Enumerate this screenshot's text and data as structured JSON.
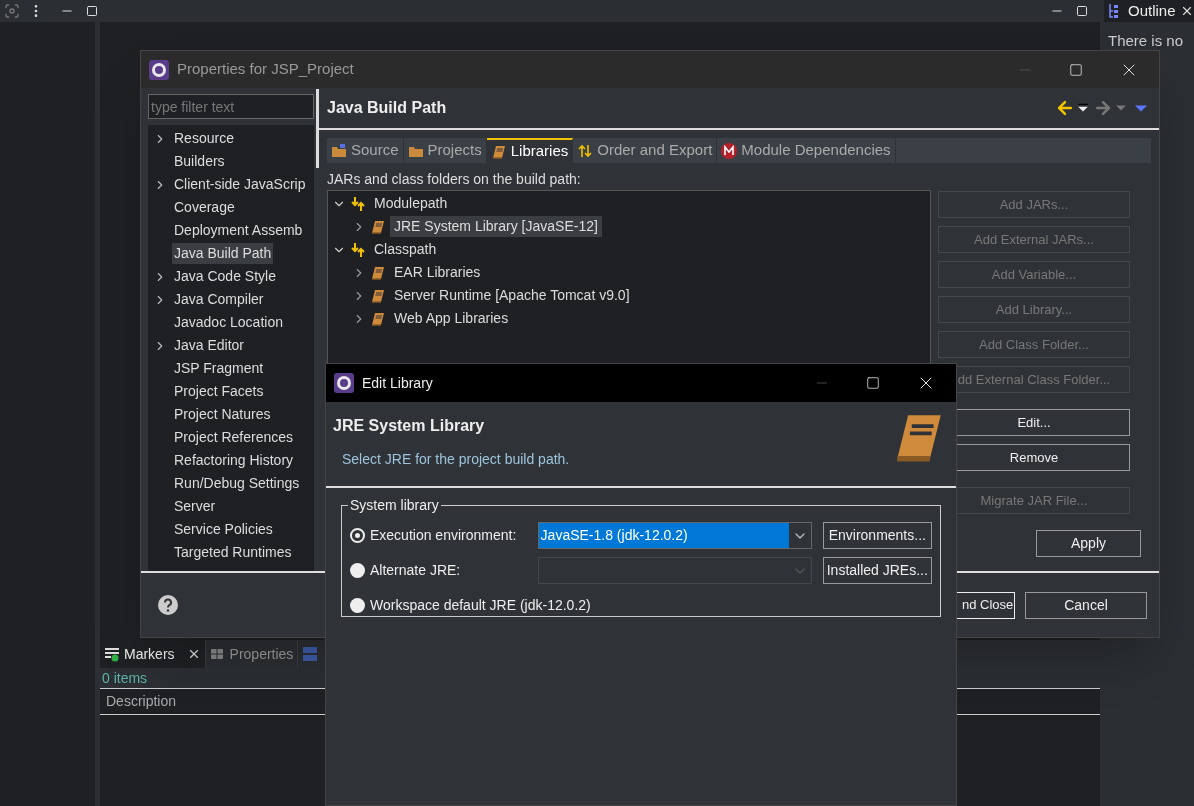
{
  "ide": {
    "outline": {
      "tab": "Outline",
      "message": "There is no"
    },
    "markers": {
      "tabs": [
        {
          "label": "Markers",
          "selected": true,
          "closable": true
        },
        {
          "label": "Properties",
          "selected": false,
          "closable": false
        }
      ],
      "count": "0 items",
      "columns": [
        "Description"
      ]
    }
  },
  "properties_dialog": {
    "title": "Properties for JSP_Project",
    "filter_placeholder": "type filter text",
    "nav": [
      {
        "label": "Resource",
        "expandable": true,
        "selected": false
      },
      {
        "label": "Builders",
        "expandable": false,
        "selected": false
      },
      {
        "label": "Client-side JavaScrip",
        "expandable": true,
        "selected": false
      },
      {
        "label": "Coverage",
        "expandable": false,
        "selected": false
      },
      {
        "label": "Deployment Assemb",
        "expandable": false,
        "selected": false
      },
      {
        "label": "Java Build Path",
        "expandable": false,
        "selected": true
      },
      {
        "label": "Java Code Style",
        "expandable": true,
        "selected": false
      },
      {
        "label": "Java Compiler",
        "expandable": true,
        "selected": false
      },
      {
        "label": "Javadoc Location",
        "expandable": false,
        "selected": false
      },
      {
        "label": "Java Editor",
        "expandable": true,
        "selected": false
      },
      {
        "label": "JSP Fragment",
        "expandable": false,
        "selected": false
      },
      {
        "label": "Project Facets",
        "expandable": false,
        "selected": false
      },
      {
        "label": "Project Natures",
        "expandable": false,
        "selected": false
      },
      {
        "label": "Project References",
        "expandable": false,
        "selected": false
      },
      {
        "label": "Refactoring History",
        "expandable": false,
        "selected": false
      },
      {
        "label": "Run/Debug Settings",
        "expandable": false,
        "selected": false
      },
      {
        "label": "Server",
        "expandable": false,
        "selected": false
      },
      {
        "label": "Service Policies",
        "expandable": false,
        "selected": false
      },
      {
        "label": "Targeted Runtimes",
        "expandable": false,
        "selected": false
      }
    ],
    "page_title": "Java Build Path",
    "tabs": [
      {
        "label": "Source",
        "kind": "source",
        "selected": false
      },
      {
        "label": "Projects",
        "kind": "projects",
        "selected": false
      },
      {
        "label": "Libraries",
        "kind": "libraries",
        "selected": true
      },
      {
        "label": "Order and Export",
        "kind": "order",
        "selected": false
      },
      {
        "label": "Module Dependencies",
        "kind": "module",
        "selected": false
      }
    ],
    "list_label": "JARs and class folders on the build path:",
    "tree": [
      {
        "label": "Modulepath",
        "expanded": true,
        "selected": false,
        "children": [
          {
            "label": "JRE System Library [JavaSE-12]",
            "selected": true
          }
        ]
      },
      {
        "label": "Classpath",
        "expanded": true,
        "selected": false,
        "children": [
          {
            "label": "EAR Libraries",
            "selected": false
          },
          {
            "label": "Server Runtime [Apache Tomcat v9.0]",
            "selected": false
          },
          {
            "label": "Web App Libraries",
            "selected": false
          }
        ]
      }
    ],
    "side_buttons": [
      {
        "label": "Add JARs...",
        "disabled": true
      },
      {
        "label": "Add External JARs...",
        "disabled": true
      },
      {
        "label": "Add Variable...",
        "disabled": true
      },
      {
        "label": "Add Library...",
        "disabled": true
      },
      {
        "label": "Add Class Folder...",
        "disabled": true
      },
      {
        "label": "dd External Class Folder...",
        "disabled": true
      },
      {
        "label": "Edit...",
        "disabled": false
      },
      {
        "label": "Remove",
        "disabled": false
      },
      {
        "label": "Migrate JAR File...",
        "disabled": true
      }
    ],
    "apply": {
      "label": "Apply"
    },
    "footer_buttons": [
      {
        "label": "nd Close",
        "default": true
      },
      {
        "label": "Cancel",
        "default": false
      }
    ]
  },
  "edit_dialog": {
    "title": "Edit Library",
    "heading": "JRE System Library",
    "description": "Select JRE for the project build path.",
    "group": "System library",
    "options": [
      {
        "label": "Execution environment:",
        "selected": true,
        "combo": {
          "value": "JavaSE-1.8 (jdk-12.0.2)",
          "disabled": false
        },
        "button": {
          "label": "Environments..."
        }
      },
      {
        "label": "Alternate JRE:",
        "selected": false,
        "combo": {
          "disabled": true
        },
        "button": {
          "label": "Installed JREs..."
        }
      },
      {
        "label": "Workspace default JRE (jdk-12.0.2)",
        "selected": false
      }
    ]
  }
}
